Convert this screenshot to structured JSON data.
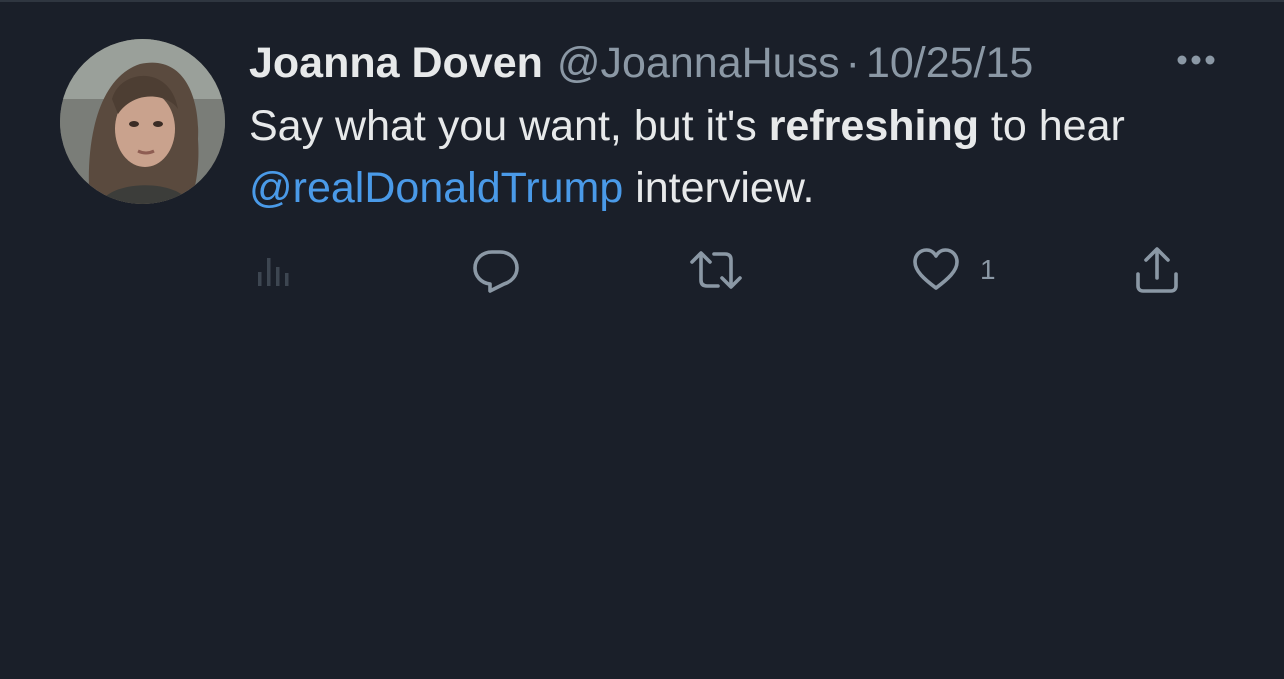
{
  "tweet": {
    "author": {
      "display_name": "Joanna Doven",
      "handle": "@JoannaHuss"
    },
    "separator": "·",
    "date": "10/25/15",
    "text": {
      "part1": "Say what you want, but it's ",
      "bold": "refreshing",
      "part2": " to hear ",
      "mention": "@realDonaldTrump",
      "part3": " interview."
    },
    "actions": {
      "like_count": "1"
    }
  },
  "icons": {
    "views": "views-icon",
    "reply": "reply-icon",
    "retweet": "retweet-icon",
    "like": "heart-icon",
    "share": "share-icon",
    "more": "more-icon"
  },
  "colors": {
    "background": "#1a1f29",
    "primary_text": "#e7e9ea",
    "secondary_text": "#8b98a5",
    "mention": "#4a9ae8"
  }
}
